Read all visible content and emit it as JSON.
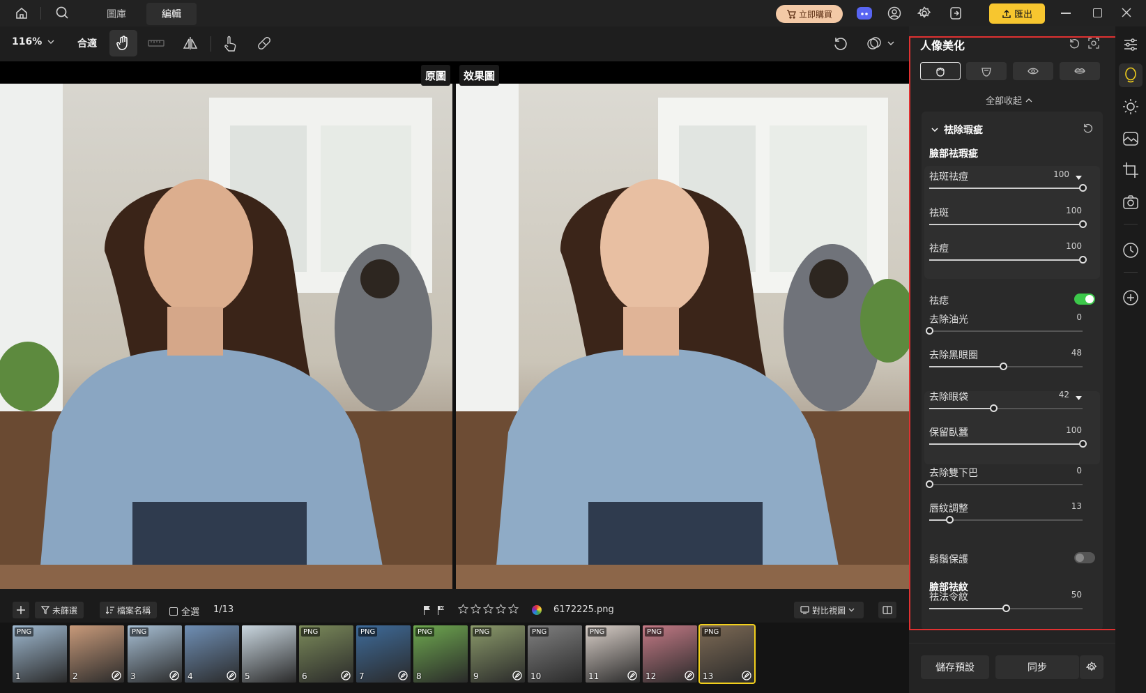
{
  "topbar": {
    "tabs": [
      "圖庫",
      "編輯"
    ],
    "buy_label": "立即購買",
    "export_label": "匯出"
  },
  "toolbar": {
    "zoom": "116%",
    "fit_label": "合適"
  },
  "view": {
    "original_label": "原圖",
    "result_label": "效果圖"
  },
  "bottombar": {
    "filter_label": "未篩選",
    "sort_label": "檔案名稱",
    "select_all_label": "全選",
    "count": "1/13",
    "filename": "6172225.png",
    "compare_label": "對比視圖"
  },
  "filmstrip": [
    {
      "num": "1",
      "png": "PNG",
      "edited": false
    },
    {
      "num": "2",
      "png": "",
      "edited": true
    },
    {
      "num": "3",
      "png": "PNG",
      "edited": true
    },
    {
      "num": "4",
      "png": "",
      "edited": true
    },
    {
      "num": "5",
      "png": "",
      "edited": false
    },
    {
      "num": "6",
      "png": "PNG",
      "edited": true
    },
    {
      "num": "7",
      "png": "PNG",
      "edited": true
    },
    {
      "num": "8",
      "png": "PNG",
      "edited": false
    },
    {
      "num": "9",
      "png": "PNG",
      "edited": true
    },
    {
      "num": "10",
      "png": "PNG",
      "edited": false
    },
    {
      "num": "11",
      "png": "PNG",
      "edited": true
    },
    {
      "num": "12",
      "png": "PNG",
      "edited": true
    },
    {
      "num": "13",
      "png": "PNG",
      "edited": true
    }
  ],
  "panel": {
    "title": "人像美化",
    "collapse_all": "全部收起",
    "section_title": "祛除瑕疵",
    "group_face": "臉部祛瑕疵",
    "group_wrinkle": "臉部祛紋",
    "sliders": [
      {
        "label": "祛斑祛痘",
        "value": "100",
        "fraction": 1.0,
        "dropdown": true
      },
      {
        "label": "祛斑",
        "value": "100",
        "fraction": 1.0
      },
      {
        "label": "祛痘",
        "value": "100",
        "fraction": 1.0
      },
      {
        "label": "去除油光",
        "value": "0",
        "fraction": 0.0
      },
      {
        "label": "去除黑眼圈",
        "value": "48",
        "fraction": 0.48
      },
      {
        "label": "去除眼袋",
        "value": "42",
        "fraction": 0.42,
        "dropdown": true
      },
      {
        "label": "保留臥蠶",
        "value": "100",
        "fraction": 1.0
      },
      {
        "label": "去除雙下巴",
        "value": "0",
        "fraction": 0.0
      },
      {
        "label": "唇紋調整",
        "value": "13",
        "fraction": 0.13
      },
      {
        "label": "祛法令紋",
        "value": "50",
        "fraction": 0.5
      }
    ],
    "toggle_mole": {
      "label": "祛痣",
      "on": true
    },
    "toggle_beard": {
      "label": "鬍鬚保護",
      "on": false
    },
    "save_preset": "儲存預設",
    "sync": "同步"
  },
  "colors": {
    "accent": "#f7c62f",
    "toggle_on": "#3cc84a",
    "highlight_box": "#e03131"
  }
}
